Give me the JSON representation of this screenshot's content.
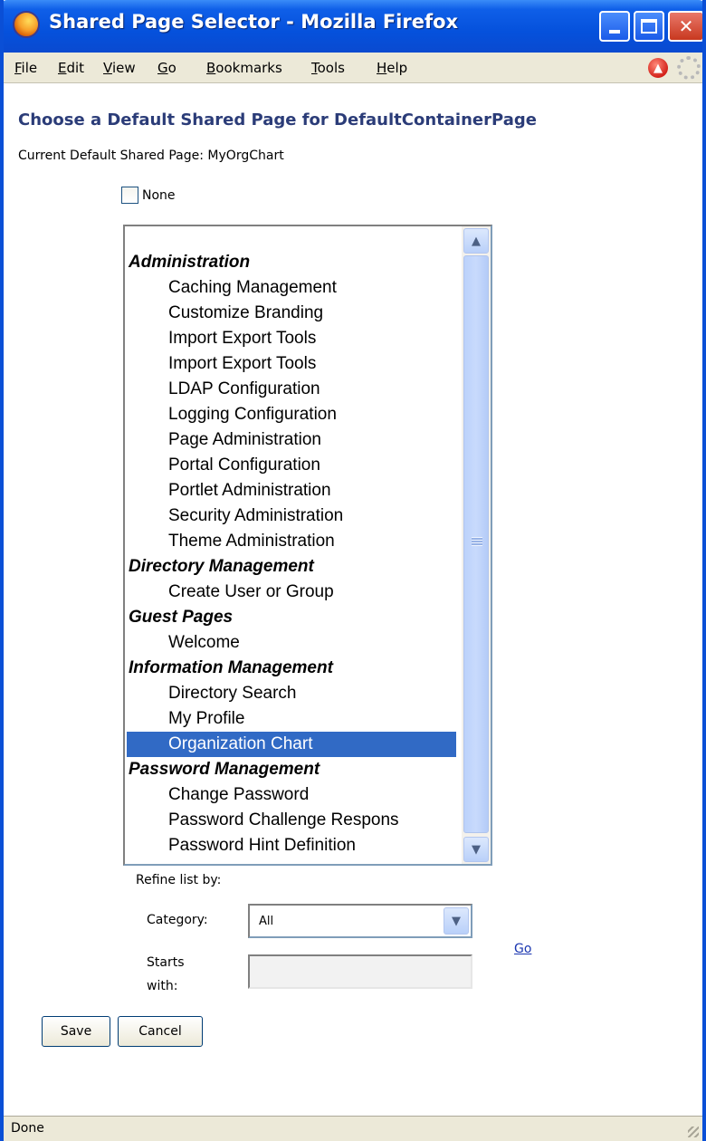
{
  "window": {
    "title": "Shared Page Selector - Mozilla Firefox",
    "buttons": [
      "minimize",
      "maximize",
      "close"
    ]
  },
  "menubar": {
    "items": [
      {
        "u": "F",
        "rest": "ile"
      },
      {
        "u": "E",
        "rest": "dit"
      },
      {
        "u": "V",
        "rest": "iew"
      },
      {
        "u": "G",
        "rest": "o"
      },
      {
        "u": "B",
        "rest": "ookmarks"
      },
      {
        "u": "T",
        "rest": "ools"
      },
      {
        "u": "H",
        "rest": "elp"
      }
    ]
  },
  "page": {
    "title": "Choose a Default Shared Page for DefaultContainerPage",
    "current_default": "Current Default Shared Page: MyOrgChart",
    "none_label": "None",
    "none_checked": false
  },
  "listbox": {
    "selected": "Organization Chart",
    "selected_color": "#316ac5",
    "items": [
      {
        "type": "group",
        "label": "Administration"
      },
      {
        "type": "item",
        "label": "Caching Management"
      },
      {
        "type": "item",
        "label": "Customize Branding"
      },
      {
        "type": "item",
        "label": "Import Export Tools"
      },
      {
        "type": "item",
        "label": "Import Export Tools"
      },
      {
        "type": "item",
        "label": "LDAP Configuration"
      },
      {
        "type": "item",
        "label": "Logging Configuration"
      },
      {
        "type": "item",
        "label": "Page Administration"
      },
      {
        "type": "item",
        "label": "Portal Configuration"
      },
      {
        "type": "item",
        "label": "Portlet Administration"
      },
      {
        "type": "item",
        "label": "Security Administration"
      },
      {
        "type": "item",
        "label": "Theme Administration"
      },
      {
        "type": "group",
        "label": "Directory Management"
      },
      {
        "type": "item",
        "label": "Create User or Group"
      },
      {
        "type": "group",
        "label": "Guest Pages"
      },
      {
        "type": "item",
        "label": "Welcome"
      },
      {
        "type": "group",
        "label": "Information Management"
      },
      {
        "type": "item",
        "label": "Directory Search"
      },
      {
        "type": "item",
        "label": "My Profile"
      },
      {
        "type": "item",
        "label": "Organization Chart",
        "selected": true
      },
      {
        "type": "group",
        "label": "Password Management"
      },
      {
        "type": "item",
        "label": "Change Password"
      },
      {
        "type": "item",
        "label": "Password Challenge Respons"
      },
      {
        "type": "item",
        "label": "Password Hint Definition"
      }
    ]
  },
  "refine": {
    "label": "Refine list by:",
    "category_label": "Category:",
    "category_value": "All",
    "starts_with_label": "Starts with:",
    "starts_with_value": "",
    "go_label": "Go"
  },
  "actions": {
    "save_label": "Save",
    "cancel_label": "Cancel"
  },
  "status": {
    "text": "Done"
  },
  "colors": {
    "titlebar": "#0551dc",
    "heading": "#2b3c78",
    "link": "#1a36b0"
  }
}
